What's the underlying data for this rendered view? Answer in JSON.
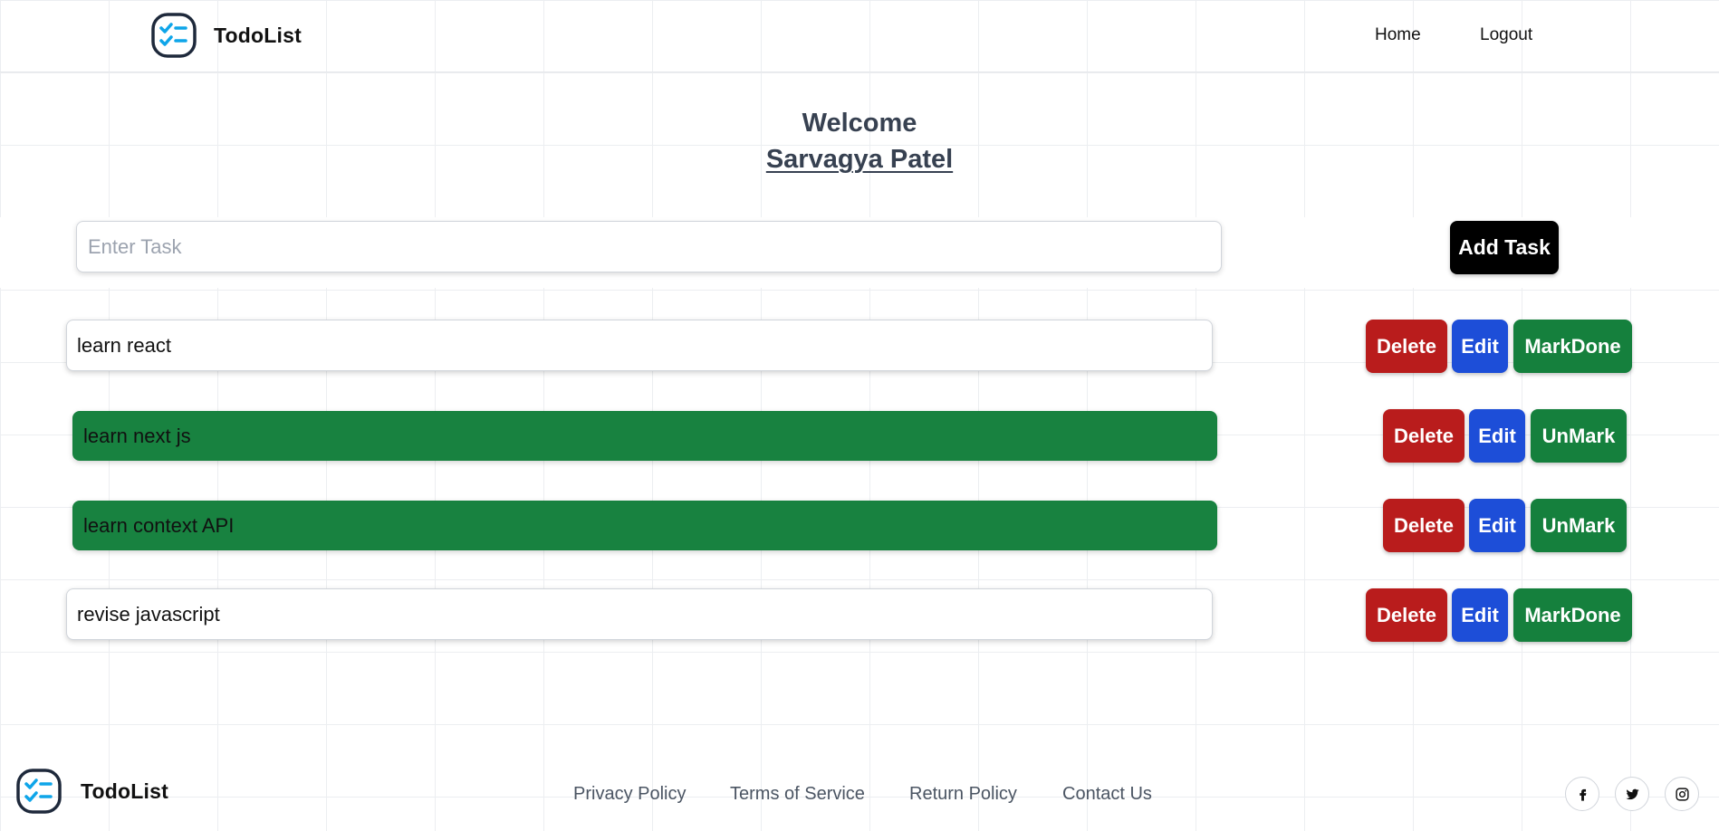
{
  "header": {
    "logo_text": "TodoList",
    "nav": {
      "home": "Home",
      "logout": "Logout"
    }
  },
  "welcome": {
    "greeting": "Welcome",
    "user_name": "Sarvagya Patel"
  },
  "new_task": {
    "placeholder": "Enter Task",
    "value": "",
    "add_label": "Add Task"
  },
  "tasks": [
    {
      "text": "learn react",
      "done": false,
      "delete_label": "Delete",
      "edit_label": "Edit",
      "toggle_label": "MarkDone"
    },
    {
      "text": "learn next js",
      "done": true,
      "delete_label": "Delete",
      "edit_label": "Edit",
      "toggle_label": "UnMark"
    },
    {
      "text": "learn context API",
      "done": true,
      "delete_label": "Delete",
      "edit_label": "Edit",
      "toggle_label": "UnMark"
    },
    {
      "text": "revise javascript",
      "done": false,
      "delete_label": "Delete",
      "edit_label": "Edit",
      "toggle_label": "MarkDone"
    }
  ],
  "footer": {
    "logo_text": "TodoList",
    "links": [
      "Privacy Policy",
      "Terms of Service",
      "Return Policy",
      "Contact Us"
    ],
    "social_icons": [
      "facebook-icon",
      "twitter-icon",
      "instagram-icon"
    ]
  },
  "colors": {
    "delete": "#b91c1c",
    "edit": "#1d4ed8",
    "done": "#15803d",
    "add": "#000000",
    "logo_blue": "#0ea5e9",
    "logo_dark": "#1e293b"
  }
}
